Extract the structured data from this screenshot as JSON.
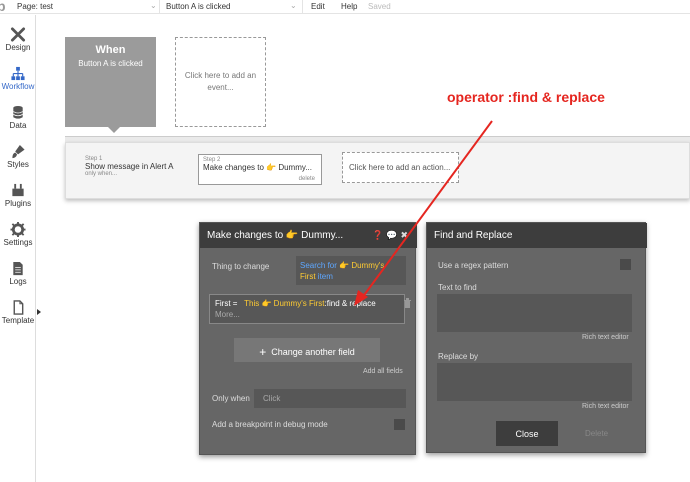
{
  "topbar": {
    "logo": "b",
    "page_label": "Page: test",
    "event_label": "Button A is clicked",
    "menu": [
      "Edit",
      "Help"
    ],
    "saved": "Saved"
  },
  "sidebar": {
    "items": [
      {
        "label": "Design",
        "icon": "design-icon"
      },
      {
        "label": "Workflow",
        "icon": "workflow-icon"
      },
      {
        "label": "Data",
        "icon": "data-icon"
      },
      {
        "label": "Styles",
        "icon": "styles-icon"
      },
      {
        "label": "Plugins",
        "icon": "plugins-icon"
      },
      {
        "label": "Settings",
        "icon": "settings-icon"
      },
      {
        "label": "Logs",
        "icon": "logs-icon"
      },
      {
        "label": "Template",
        "icon": "template-icon"
      }
    ],
    "active_color": "#3468c8"
  },
  "canvas": {
    "when_title": "When",
    "when_event": "Button A is clicked",
    "add_event": "Click here to add an event...",
    "steps": [
      {
        "num": "Step 1",
        "name": "Show message in Alert A",
        "sub": "only when..."
      },
      {
        "num": "Step 2",
        "name": "Make changes to 👉 Dummy...",
        "sub": "delete"
      }
    ],
    "add_action": "Click here to add an action..."
  },
  "editor": {
    "title": "Make changes to 👉 Dummy...",
    "thing_label": "Thing to change",
    "thing_value_a": "Search for ",
    "thing_value_b": "👉 Dummy's First",
    "thing_value_c": " item",
    "field_name": "First",
    "field_eq": "=",
    "field_this": "This ",
    "field_obj": "👉 Dummy's First",
    "field_op": ":find & replace",
    "more": "More...",
    "change_field": "Change another field",
    "add_all": "Add all fields",
    "only_when": "Only when",
    "only_when_placeholder": "Click",
    "breakpoint": "Add a breakpoint in debug mode"
  },
  "find_replace": {
    "title": "Find and Replace",
    "regex": "Use a regex pattern",
    "find_label": "Text to find",
    "replace_label": "Replace by",
    "rte": "Rich text editor",
    "close": "Close",
    "delete": "Delete"
  },
  "annotation": {
    "text": "operator :find & replace",
    "color": "#e52620"
  }
}
